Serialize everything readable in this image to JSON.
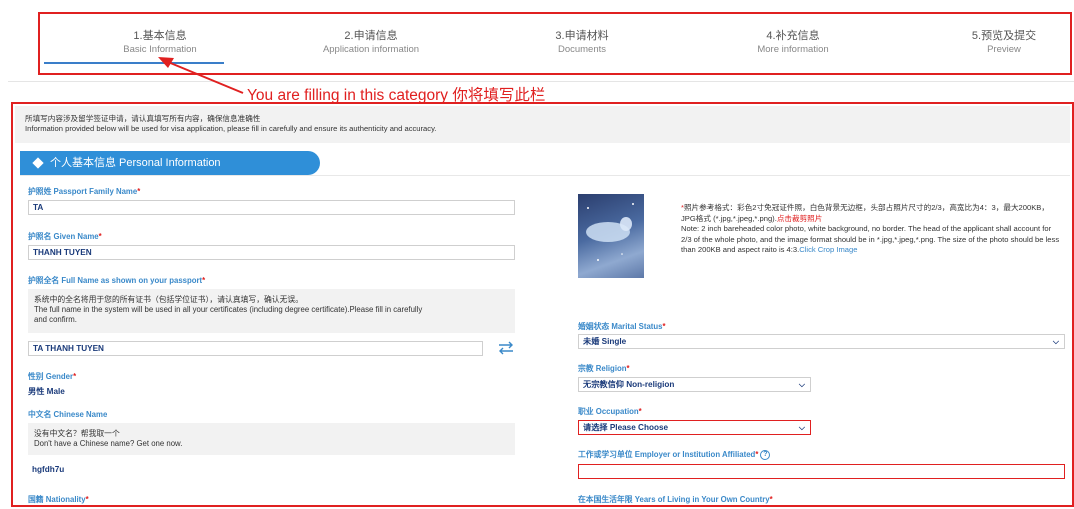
{
  "steps": [
    {
      "cn": "1.基本信息",
      "en": "Basic Information"
    },
    {
      "cn": "2.申请信息",
      "en": "Application information"
    },
    {
      "cn": "3.申请材料",
      "en": "Documents"
    },
    {
      "cn": "4.补充信息",
      "en": "More information"
    },
    {
      "cn": "5.预览及提交",
      "en": "Preview"
    }
  ],
  "annotation": "You are filling in this category 你将填写此栏",
  "notice": {
    "cn": "所填写内容涉及留学签证申请，请认真填写所有内容，确保信息准确性",
    "en": "Information provided below will be used for visa application, please fill in carefully and ensure its authenticity and accuracy."
  },
  "section_title": "个人基本信息 Personal Information",
  "fields": {
    "family_name": {
      "label": "护照姓 Passport Family Name",
      "value": "TA"
    },
    "given_name": {
      "label": "护照名 Given Name",
      "value": "THANH TUYEN"
    },
    "full_name": {
      "label": "护照全名 Full Name as shown on your passport",
      "hint_cn": "系统中的全名将用于您的所有证书（包括学位证书），请认真填写，确认无误。",
      "hint_en1": "The full name in the system will be used in all your certificates (including degree certificate).Please fill in carefully",
      "hint_en2": "and confirm.",
      "value": "TA THANH TUYEN"
    },
    "gender": {
      "label": "性别 Gender",
      "value": "男性 Male"
    },
    "chinese_name": {
      "label": "中文名 Chinese Name",
      "hint_cn": "没有中文名？帮我取一个",
      "hint_en": "Don't have a Chinese name? Get one now.",
      "value": "hgfdh7u"
    },
    "nationality": {
      "label": "国籍 Nationality"
    },
    "marital_status": {
      "label": "婚姻状态 Marital Status",
      "value": "未婚 Single"
    },
    "religion": {
      "label": "宗教 Religion",
      "value": "无宗教信仰 Non-religion"
    },
    "occupation": {
      "label": "职业 Occupation",
      "value": "请选择 Please Choose"
    },
    "employer": {
      "label": "工作或学习单位 Employer or Institution Affiliated",
      "value": ""
    },
    "years_living": {
      "label": "在本国生活年限 Years of Living in Your Own Country"
    }
  },
  "photo_note": {
    "cn_a": "照片参考格式：彩色2寸免冠证件照，白色背景无边框，头部占照片尺寸的2/3，高宽比为4：3，最大200KB，JPG格式 (*.jpg,*.jpeg,*.png).",
    "cn_link": "点击裁剪照片",
    "en_a": "Note: 2 inch bareheaded color photo, white background, no border. The head of the applicant shall account for 2/3 of the whole photo, and the image format should be in *.jpg,*.jpeg,*.png. The size of the photo should be less than 200KB and aspect raito is 4:3.",
    "en_link": "Click Crop Image"
  },
  "required_mark": "*",
  "icons": {
    "swap": "swap-icon",
    "chevron": "chevron-down-icon",
    "help": "question-icon"
  },
  "colors": {
    "accent": "#2f8fd8",
    "highlight": "#e02020",
    "label": "#3a89c9",
    "value": "#1a3a7a"
  }
}
